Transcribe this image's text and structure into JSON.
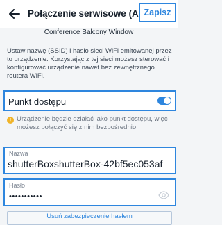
{
  "header": {
    "title": "Połączenie serwisowe (AP)",
    "save_label": "Zapisz",
    "back_icon": "arrow-left-icon"
  },
  "subtitle": "Conference Balcony Window",
  "description": "Ustaw nazwę (SSID) i hasło sieci WiFi emitowanej przez to urządzenie. Korzystając z tej sieci możesz sterować i konfigurować urządzenie nawet bez zewnętrznego routera WiFi.",
  "access_point": {
    "label": "Punkt dostępu",
    "enabled": true
  },
  "info": {
    "icon": "warning-icon",
    "text": "Urządzenie będzie działać jako punkt dostępu, więc możesz połączyć się z nim bezpośrednio."
  },
  "name_field": {
    "label": "Nazwa",
    "value": "shutterBoxshutterBox-42bf5ec053af"
  },
  "password_field": {
    "label": "Hasło",
    "value": "•••••••••••",
    "eye_icon": "eye-icon"
  },
  "remove_password_label": "Usuń zabezpieczenie hasłem",
  "colors": {
    "accent": "#2e86de",
    "warning": "#f0b429",
    "background": "#f3f5f7"
  }
}
